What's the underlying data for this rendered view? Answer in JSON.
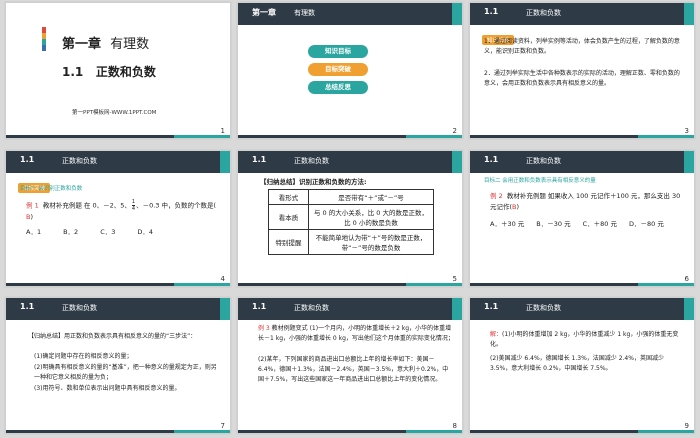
{
  "slides": [
    {
      "number": "1",
      "chapter": "第一章",
      "chapter_name": "有理数",
      "section": "1.1",
      "section_title": "正数和负数",
      "footer": "第一PPT模板网-WWW.1PPT.COM"
    },
    {
      "number": "2",
      "header_chapter": "第一章",
      "header_name": "有理数",
      "buttons": [
        "知识目标",
        "目标突破",
        "总结反思"
      ]
    },
    {
      "number": "3",
      "header": "1.1",
      "header_title": "正数和负数",
      "badge": "知识目标",
      "item1": "1．通过阅读资料，列举实例等活动，体会负数产生的过程，了解负数的意义，能识别正数和负数。",
      "item2": "2．通过列举实际生活中各种数表示的实际的活动，理解正数、零和负数的意义，会用正数和负数表示具有相反意义的量。"
    },
    {
      "number": "4",
      "header": "1.1",
      "header_title": "正数和负数",
      "badge": "目标突破",
      "target": "目标一  会识别正数和负数",
      "example_label": "例 1",
      "example_text": "教材补充例题 在 0、－2、5、",
      "frac_num": "1",
      "frac_den": "4",
      "example_text2": "、－0.3 中，负数的个数是(",
      "answer": "B",
      "example_end": ")",
      "options": [
        "A．1",
        "B．2",
        "C．3",
        "D．4"
      ]
    },
    {
      "number": "5",
      "header": "1.1",
      "header_title": "正数和负数",
      "title": "【归纳总结】识别正数和负数的方法:",
      "rows": [
        [
          "看形式",
          "是否带有“＋”或“－”号"
        ],
        [
          "看本质",
          "与 0 的大小关系，比 0 大的数是正数，比 0 小的数是负数"
        ],
        [
          "特别提醒",
          "不能简单地认为带“＋”号的数是正数，带“－”号的数是负数"
        ]
      ]
    },
    {
      "number": "6",
      "header": "1.1",
      "header_title": "正数和负数",
      "target": "目标二  会用正数和负数表示具有相反意义的量",
      "example_label": "例 2",
      "example_text": "教材补充例题 如果收入 100 元记作＋100 元，那么支出 30 元记作(",
      "answer": "B",
      "example_end": ")",
      "options": [
        "A．＋30 元",
        "B．－30 元",
        "C．＋80 元",
        "D．－80 元"
      ]
    },
    {
      "number": "7",
      "header": "1.1",
      "header_title": "正数和负数",
      "text": "【归纳总结】用正数和负数表示具有相反意义的量的“三步法”：",
      "steps": [
        "(1)确定问题中存在的相反意义的量；",
        "(2)明确具有相反意义的量的“基准”，把一种意义的量规定为正，则另一种和它意义相反的量为负；",
        "(3)用符号、数和单位表示出问题中具有相反意义的量。"
      ]
    },
    {
      "number": "8",
      "header": "1.1",
      "header_title": "正数和负数",
      "example_label": "例 3",
      "text": "教材例题变式 (1)一个月内，小明的体重增长＋2 kg，小华的体重增长－1 kg，小强的体重增长 0 kg，写出他们这个月体重的实际变化情况；",
      "text2": "(2)某年，下列国家的商品进出口总额比上年的增长率如下：美国－6.4%，德国＋1.3%，法国－2.4%，英国－3.5%，意大利＋0.2%，中国＋7.5%，写出这些国家这一年商品进出口总额比上年的变化情况。"
    },
    {
      "number": "9",
      "header": "1.1",
      "header_title": "正数和负数",
      "solve_label": "解：",
      "text": "(1)小明的体重增加 2 kg，小华的体重减少 1 kg，小强的体重无变化。",
      "text2": "(2)美国减少 6.4%，德国增长 1.3%，法国减少 2.4%，英国减少 3.5%，意大利增长 0.2%，中国增长 7.5%。"
    }
  ],
  "colors": {
    "dark": "#2e3b46",
    "teal": "#2aa5a0",
    "red": "#d33",
    "orange": "#f0a030"
  }
}
